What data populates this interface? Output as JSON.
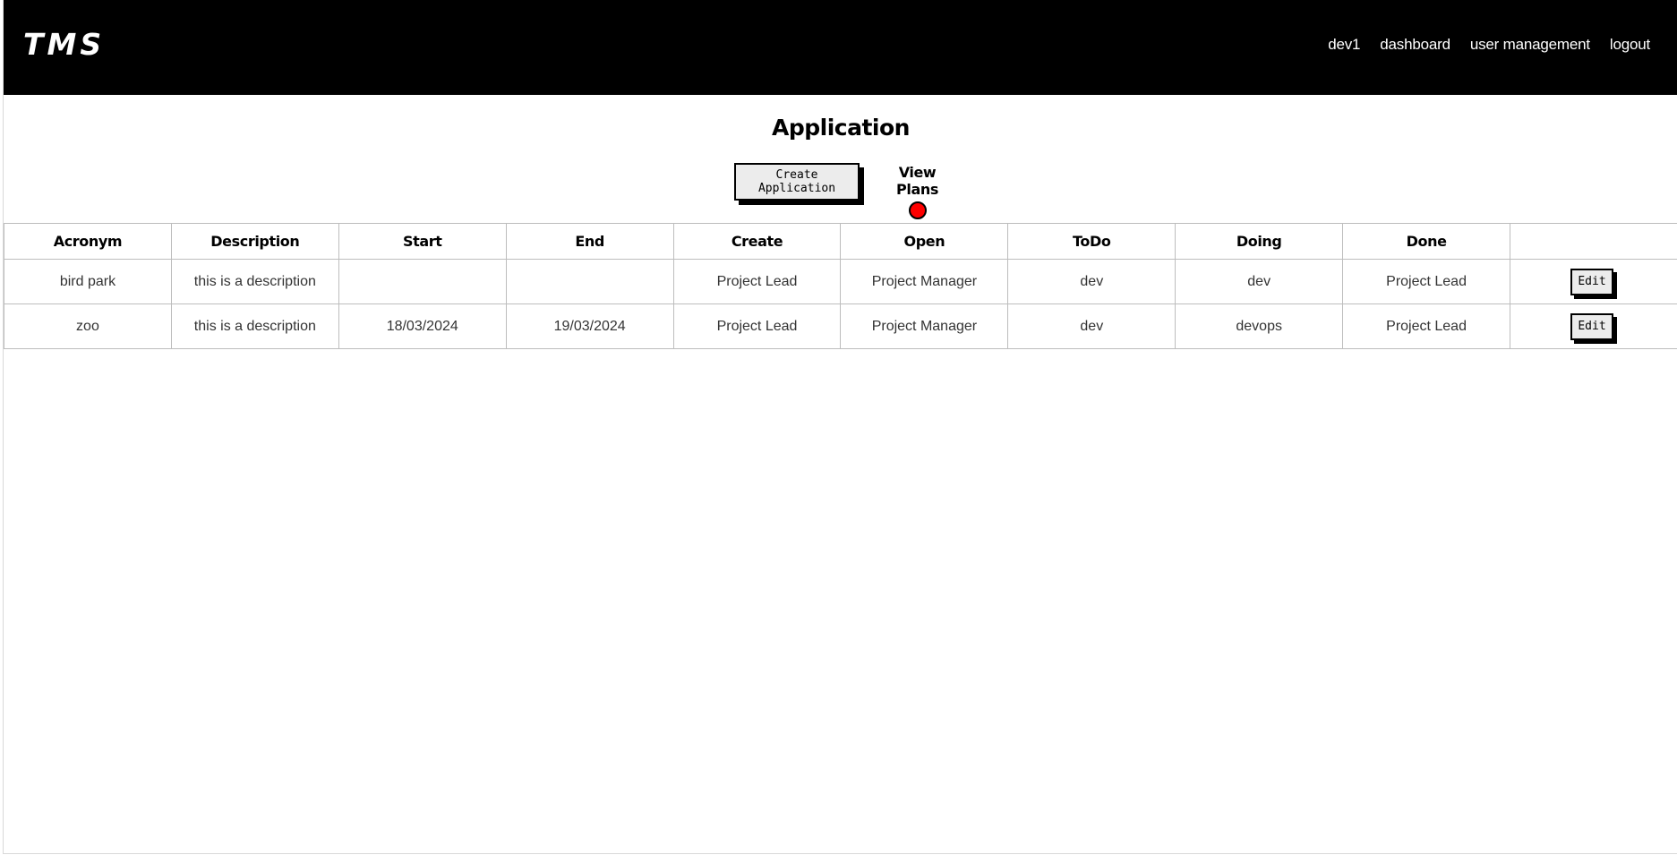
{
  "brand": "TMS",
  "nav": {
    "items": [
      "dev1",
      "dashboard",
      "user management",
      "logout"
    ]
  },
  "page": {
    "title": "Application"
  },
  "actions": {
    "create_label": "Create Application",
    "view_plans_label": "View Plans",
    "view_plans_toggle_color": "#ff0000"
  },
  "table": {
    "columns": [
      "Acronym",
      "Description",
      "Start",
      "End",
      "Create",
      "Open",
      "ToDo",
      "Doing",
      "Done",
      ""
    ],
    "rows": [
      {
        "acronym": "bird park",
        "description": "this is a description",
        "start": "",
        "end": "",
        "create": "Project Lead",
        "open": "Project Manager",
        "todo": "dev",
        "doing": "dev",
        "done": "Project Lead",
        "edit_label": "Edit"
      },
      {
        "acronym": "zoo",
        "description": "this is a description",
        "start": "18/03/2024",
        "end": "19/03/2024",
        "create": "Project Lead",
        "open": "Project Manager",
        "todo": "dev",
        "doing": "devops",
        "done": "Project Lead",
        "edit_label": "Edit"
      }
    ]
  }
}
